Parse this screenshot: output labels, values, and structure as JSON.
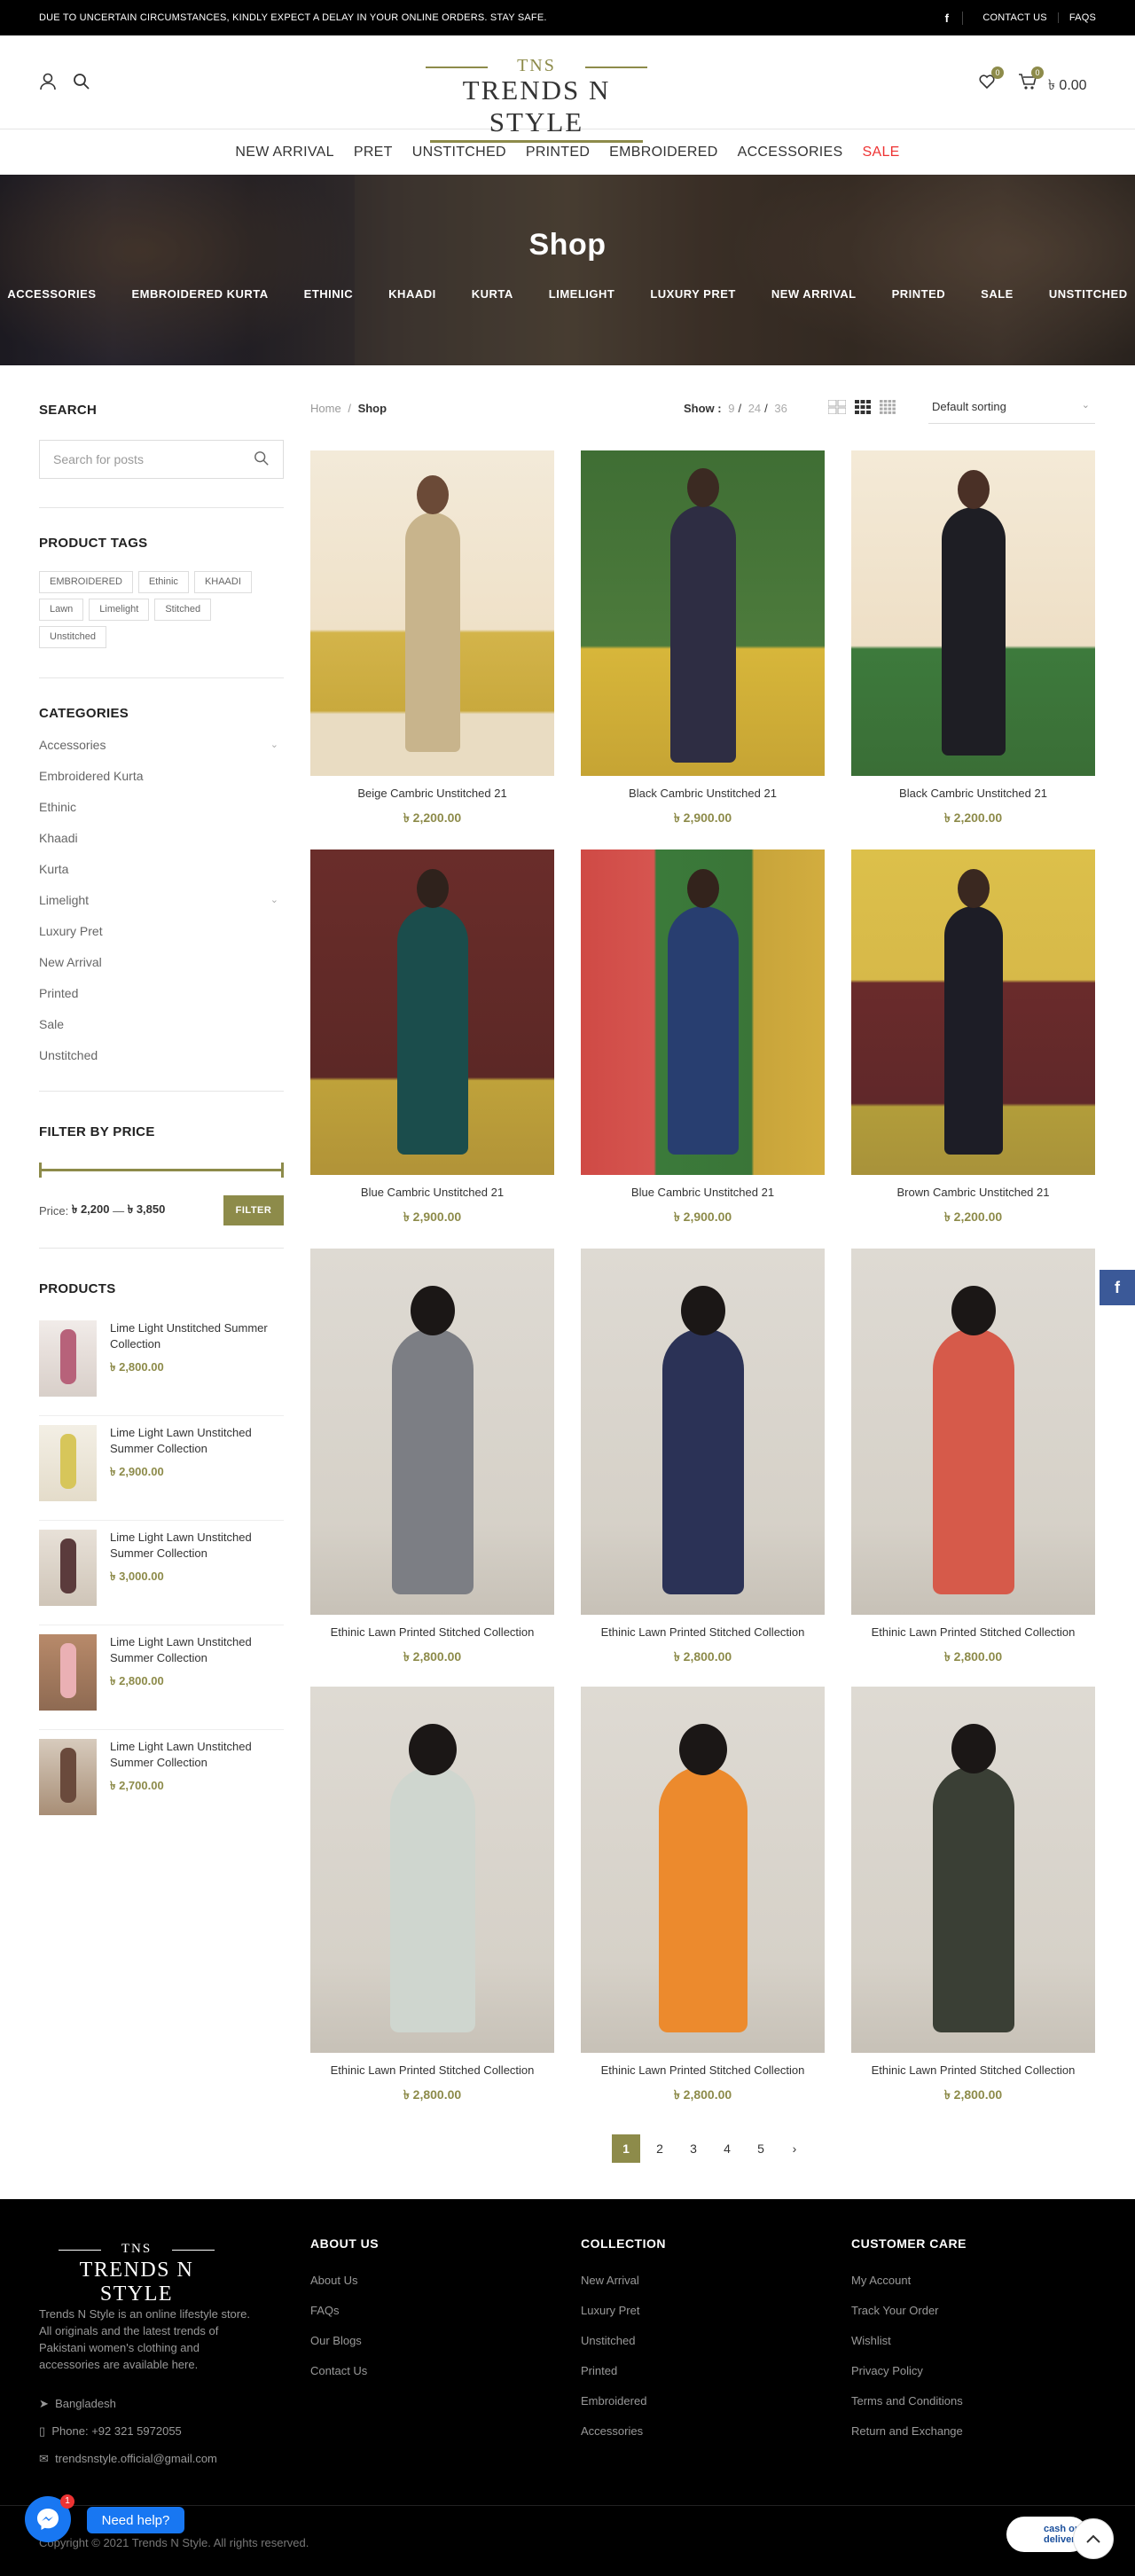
{
  "topbar": {
    "notice": "DUE TO UNCERTAIN CIRCUMSTANCES, KINDLY EXPECT A DELAY IN YOUR ONLINE ORDERS. STAY SAFE.",
    "facebook": "f",
    "links": [
      "CONTACT US",
      "FAQS"
    ]
  },
  "header": {
    "logo_top": "TNS",
    "logo_name": "TRENDS N STYLE",
    "wishlist_count": "0",
    "cart_count": "0",
    "cart_total": "৳ 0.00"
  },
  "nav": [
    "NEW ARRIVAL",
    "PRET",
    "UNSTITCHED",
    "PRINTED",
    "EMBROIDERED",
    "ACCESSORIES",
    "SALE"
  ],
  "hero": {
    "title": "Shop",
    "categories": [
      "ACCESSORIES",
      "EMBROIDERED KURTA",
      "ETHINIC",
      "KHAADI",
      "KURTA",
      "LIMELIGHT",
      "LUXURY PRET",
      "NEW ARRIVAL",
      "PRINTED",
      "SALE",
      "UNSTITCHED"
    ]
  },
  "sidebar": {
    "search_title": "SEARCH",
    "search_placeholder": "Search for posts",
    "tags_title": "PRODUCT TAGS",
    "tags": [
      "EMBROIDERED",
      "Ethinic",
      "KHAADI",
      "Lawn",
      "Limelight",
      "Stitched",
      "Unstitched"
    ],
    "categories_title": "CATEGORIES",
    "categories": [
      "Accessories",
      "Embroidered Kurta",
      "Ethinic",
      "Khaadi",
      "Kurta",
      "Limelight",
      "Luxury Pret",
      "New Arrival",
      "Printed",
      "Sale",
      "Unstitched"
    ],
    "filter_title": "FILTER BY PRICE",
    "price_label": "Price:",
    "price_min": "৳ 2,200",
    "price_sep": "—",
    "price_max": "৳ 3,850",
    "filter_button": "FILTER",
    "products_title": "PRODUCTS",
    "products": [
      {
        "name": "Lime Light Unstitched Summer Collection",
        "price": "৳ 2,800.00"
      },
      {
        "name": "Lime Light Lawn Unstitched Summer Collection",
        "price": "৳ 2,900.00"
      },
      {
        "name": "Lime Light Lawn Unstitched Summer Collection",
        "price": "৳ 3,000.00"
      },
      {
        "name": "Lime Light Lawn Unstitched Summer Collection",
        "price": "৳ 2,800.00"
      },
      {
        "name": "Lime Light Lawn Unstitched Summer Collection",
        "price": "৳ 2,700.00"
      }
    ]
  },
  "toolbar": {
    "breadcrumb_home": "Home",
    "breadcrumb_sep": "/",
    "breadcrumb_current": "Shop",
    "show_label": "Show :",
    "show_options": [
      "9",
      "24",
      "36"
    ],
    "sort": "Default sorting"
  },
  "products": [
    {
      "title": "Beige Cambric Unstitched 21",
      "price": "৳ 2,200.00"
    },
    {
      "title": "Black Cambric Unstitched 21",
      "price": "৳ 2,900.00"
    },
    {
      "title": "Black Cambric Unstitched 21",
      "price": "৳ 2,200.00"
    },
    {
      "title": "Blue Cambric Unstitched 21",
      "price": "৳ 2,900.00"
    },
    {
      "title": "Blue Cambric Unstitched 21",
      "price": "৳ 2,900.00"
    },
    {
      "title": "Brown Cambric Unstitched 21",
      "price": "৳ 2,200.00"
    },
    {
      "title": "Ethinic Lawn Printed Stitched Collection",
      "price": "৳ 2,800.00"
    },
    {
      "title": "Ethinic Lawn Printed Stitched Collection",
      "price": "৳ 2,800.00"
    },
    {
      "title": "Ethinic Lawn Printed Stitched Collection",
      "price": "৳ 2,800.00"
    },
    {
      "title": "Ethinic Lawn Printed Stitched Collection",
      "price": "৳ 2,800.00"
    },
    {
      "title": "Ethinic Lawn Printed Stitched Collection",
      "price": "৳ 2,800.00"
    },
    {
      "title": "Ethinic Lawn Printed Stitched Collection",
      "price": "৳ 2,800.00"
    }
  ],
  "pagination": [
    "1",
    "2",
    "3",
    "4",
    "5"
  ],
  "footer": {
    "logo_top": "TNS",
    "logo_name": "TRENDS N STYLE",
    "description": "Trends N Style is an online lifestyle store. All originals and the latest trends of Pakistani women's clothing and accessories are available here.",
    "address": "Bangladesh",
    "phone": "Phone: +92 321 5972055",
    "email": "trendsnstyle.official@gmail.com",
    "about_title": "ABOUT US",
    "about_links": [
      "About Us",
      "FAQs",
      "Our Blogs",
      "Contact Us"
    ],
    "collection_title": "COLLECTION",
    "collection_links": [
      "New Arrival",
      "Luxury Pret",
      "Unstitched",
      "Printed",
      "Embroidered",
      "Accessories"
    ],
    "care_title": "CUSTOMER CARE",
    "care_links": [
      "My Account",
      "Track Your Order",
      "Wishlist",
      "Privacy Policy",
      "Terms and Conditions",
      "Return and Exchange"
    ],
    "copyright": "Copyright © 2021 Trends N Style. All rights reserved."
  },
  "widgets": {
    "need_help": "Need help?",
    "msg_badge": "1",
    "cash_text": "cash on delivery"
  },
  "colors": {
    "accent": "#8d8b4a",
    "sale": "#e33333",
    "topbar": "#000000"
  }
}
